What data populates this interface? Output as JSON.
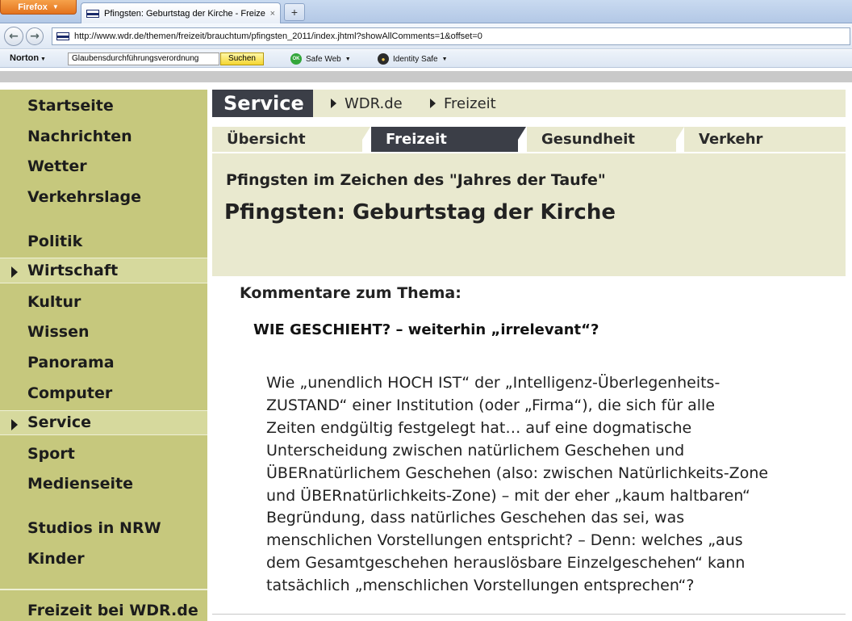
{
  "browser": {
    "firefox_button": "Firefox",
    "tab_title": "Pfingsten: Geburtstag der Kirche - Freizei...",
    "url": "http://www.wdr.de/themen/freizeit/brauchtum/pfingsten_2011/index.jhtml?showAllComments=1&offset=0",
    "norton_label": "Norton",
    "search_value": "Glaubensdurchführungsverordnung",
    "search_button": "Suchen",
    "safe_web_icon_text": "OK",
    "safe_web": "Safe Web",
    "identity_safe": "Identity Safe"
  },
  "sidebar": {
    "items": [
      {
        "label": "Startseite"
      },
      {
        "label": "Nachrichten"
      },
      {
        "label": "Wetter"
      },
      {
        "label": "Verkehrslage"
      },
      {
        "label": "Politik"
      },
      {
        "label": "Wirtschaft"
      },
      {
        "label": "Kultur"
      },
      {
        "label": "Wissen"
      },
      {
        "label": "Panorama"
      },
      {
        "label": "Computer"
      },
      {
        "label": "Service"
      },
      {
        "label": "Sport"
      },
      {
        "label": "Medienseite"
      },
      {
        "label": "Studios in NRW"
      },
      {
        "label": "Kinder"
      },
      {
        "label": "Freizeit bei WDR.de"
      }
    ]
  },
  "section": {
    "title": "Service",
    "breadcrumbs": [
      "WDR.de",
      "Freizeit"
    ]
  },
  "tabs": [
    {
      "label": "Übersicht"
    },
    {
      "label": "Freizeit"
    },
    {
      "label": "Gesundheit"
    },
    {
      "label": "Verkehr"
    }
  ],
  "article": {
    "kicker": "Pfingsten im Zeichen des \"Jahres der Taufe\"",
    "headline": "Pfingsten: Geburtstag der Kirche"
  },
  "comments": {
    "heading": "Kommentare zum Thema:",
    "title": "WIE GESCHIEHT? – weiterhin „irrelevant“?",
    "body": "Wie „unendlich HOCH IST“ der „Intelligenz-Überlegenheits-\nZUSTAND“ einer Institution (oder „Firma“), die sich für alle\nZeiten endgültig festgelegt hat… auf eine dogmatische\nUnterscheidung zwischen natürlichem Geschehen und\nÜBERnatürlichem Geschehen (also: zwischen Natürlichkeits-Zone\nund ÜBERnatürlichkeits-Zone) – mit der eher „kaum haltbaren“\nBegründung, dass natürliches Geschehen das sei, was\nmenschlichen Vorstellungen entspricht? – Denn: welches „aus\ndem Gesamtgeschehen herauslösbare Einzelgeschehen“ kann\ntatsächlich „menschlichen Vorstellungen entsprechen“?"
  }
}
